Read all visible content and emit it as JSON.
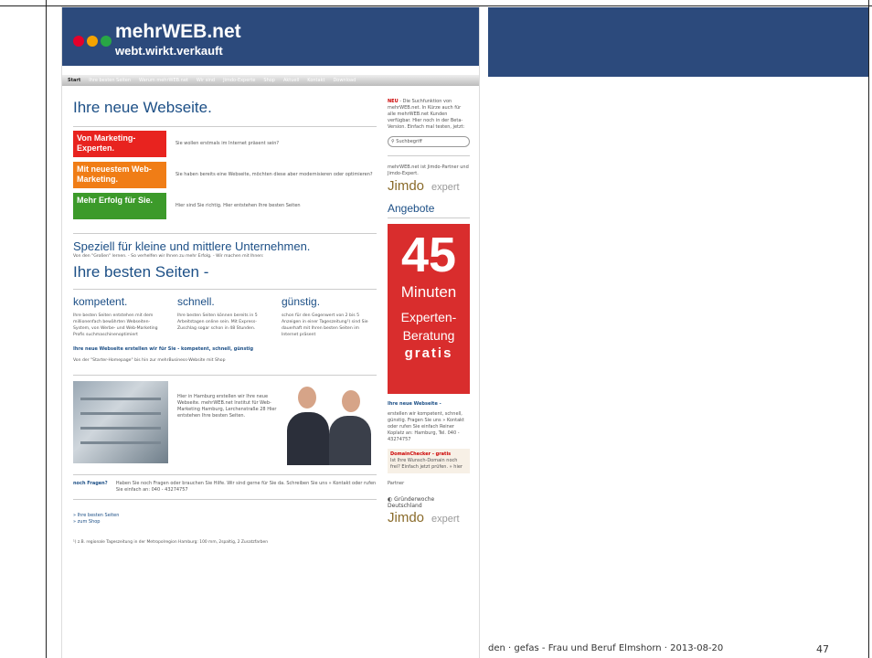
{
  "header": {
    "logo_text": "mehrWEB.net",
    "tagline": "webt.wirkt.verkauft",
    "logo_dot_colors": [
      "#e4002b",
      "#f5a300",
      "#28a745"
    ]
  },
  "nav": {
    "items": [
      "Start",
      "Ihre besten Seiten",
      "Warum mehrWEB.net",
      "Wir sind",
      "Jimdo-Experte",
      "Shop",
      "Aktuell",
      "Kontakt",
      "Download"
    ]
  },
  "main": {
    "title": "Ihre neue Webseite.",
    "promos": [
      {
        "label": "Von Marketing-Experten.",
        "text": "Sie wollen erstmals im Internet präsent sein?",
        "color": "#e8231f"
      },
      {
        "label": "Mit neuestem Web-Marketing.",
        "text": "Sie haben bereits eine Webseite, möchten diese aber modernisieren oder optimieren?",
        "color": "#f07d16"
      },
      {
        "label": "Mehr Erfolg für Sie.",
        "text": "Hier sind Sie richtig. Hier entstehen Ihre besten Seiten",
        "color": "#3c9a2a"
      }
    ],
    "subtitle": "Speziell für kleine und mittlere Unternehmen.",
    "subtitle_note": "Von den \"Großen\" lernen. - So verhelfen wir Ihnen zu mehr Erfolg. - Wir machen mit Ihnen:",
    "best_title": "Ihre besten Seiten -",
    "columns": [
      {
        "heading": "kompetent.",
        "text": "Ihre besten Seiten entstehen mit dem millionenfach bewährten Webseiten-System, von Werbe- und Web-Marketing Profis suchmaschinenoptimiert"
      },
      {
        "heading": "schnell.",
        "text": "Ihre besten Seiten können bereits in 5 Arbeitstagen online sein. Mit Express-Zuschlag sogar schon in 48 Stunden."
      },
      {
        "heading": "günstig.",
        "text": "schon für den Gegenwert von 2 bis 5 Anzeigen in einer Tageszeitung¹) sind Sie dauerhaft mit Ihren besten Seiten im Internet präsent"
      }
    ],
    "bold_link": "Ihre neue Webseite erstellen wir für Sie - kompetent, schnell, günstig",
    "starter_note": "Von der \"Starter-Homepage\" bis hin zur mehrBusiness-Website mit Shop",
    "photo_text": "Hier in Hamburg erstellen wir Ihre neue Webseite. mehrWEB.net Institut für Web-Marketing Hamburg, Lerchenstraße 28 Hier entstehen Ihre besten Seiten.",
    "questions_label": "noch Fragen?",
    "questions_text": "Haben Sie noch Fragen oder brauchen Sie Hilfe. Wir sind gerne für Sie da. Schreiben Sie uns » Kontakt oder rufen Sie einfach an: 040 - 43274757",
    "links": [
      "» Ihre besten Seiten",
      "» zum Shop"
    ],
    "footnote": "¹) z.B. regionale Tageszeitung in der Metropolregion Hamburg: 100 mm, 2spaltig, 2 Zusatzfarben"
  },
  "sidebar": {
    "neu_label": "NEU",
    "neu_text": "- Die Suchfunktion von mehrWEB.net. In Kürze auch für alle mehrWEB.net Kunden verfügbar. Hier noch in der Beta-Version. Einfach mal testen, jetzt:",
    "search_placeholder": "Suchbegriff",
    "jimdo_note": "mehrWEB.net ist Jimdo-Partner und Jimdo-Expert.",
    "jimdo_logo": "Jimdo",
    "jimdo_expert": "expert",
    "angebote": "Angebote",
    "ad_number": "45",
    "ad_minutes": "Minuten",
    "ad_line1": "Experten-",
    "ad_line2": "Beratung",
    "ad_gratis": "gratis",
    "new_site_title": "Ihre neue Webseite -",
    "new_site_text": "erstellen wir kompetent, schnell, günstig. Fragen Sie uns » Kontakt oder rufen Sie einfach Reiner Koplatz an: Hamburg, Tel. 040 - 43274757",
    "domain_title": "DomainChecker - gratis",
    "domain_text": "Ist Ihre Wunsch-Domain noch frei? Einfach jetzt prüfen. » hier",
    "partner_label": "Partner",
    "partner1": "Gründerwoche Deutschland"
  },
  "footer": {
    "text": "den · gefas - Frau und Beruf Elmshorn · 2013-08-20",
    "page": "47"
  }
}
